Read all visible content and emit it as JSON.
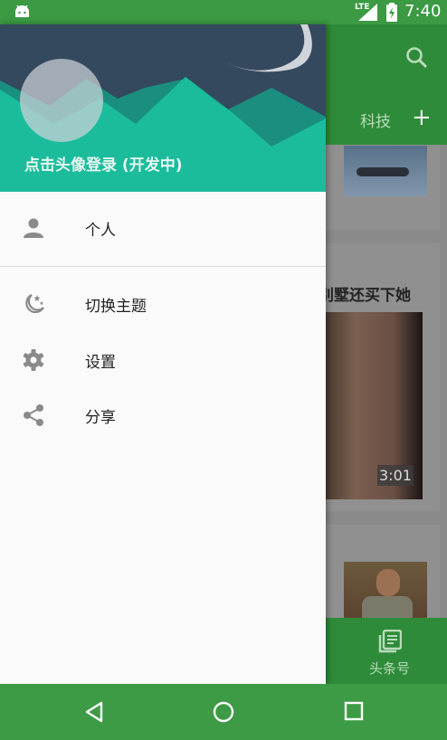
{
  "status_bar": {
    "network": "LTE",
    "time": "7:40"
  },
  "background_app": {
    "tab_label": "科技",
    "add_symbol": "+",
    "headline_partial": "别墅还买下她",
    "video_duration": "3:01",
    "bottom_tab_label": "头条号"
  },
  "drawer": {
    "login_text": "点击头像登录 (开发中)",
    "items": [
      {
        "label": "个人",
        "icon": "person-icon"
      },
      {
        "label": "切换主题",
        "icon": "moon-stars-icon"
      },
      {
        "label": "设置",
        "icon": "gear-icon"
      },
      {
        "label": "分享",
        "icon": "share-icon"
      }
    ]
  },
  "nav_bar": {
    "buttons": [
      "back",
      "home",
      "recents"
    ]
  },
  "colors": {
    "status_bar": "#3b9a42",
    "toolbar": "#2e8b39",
    "drawer_header_sky": "#34495e",
    "mountain": "#1abc9c",
    "drawer_bg": "#fafafa",
    "icon_gray": "#8a8a8a"
  }
}
